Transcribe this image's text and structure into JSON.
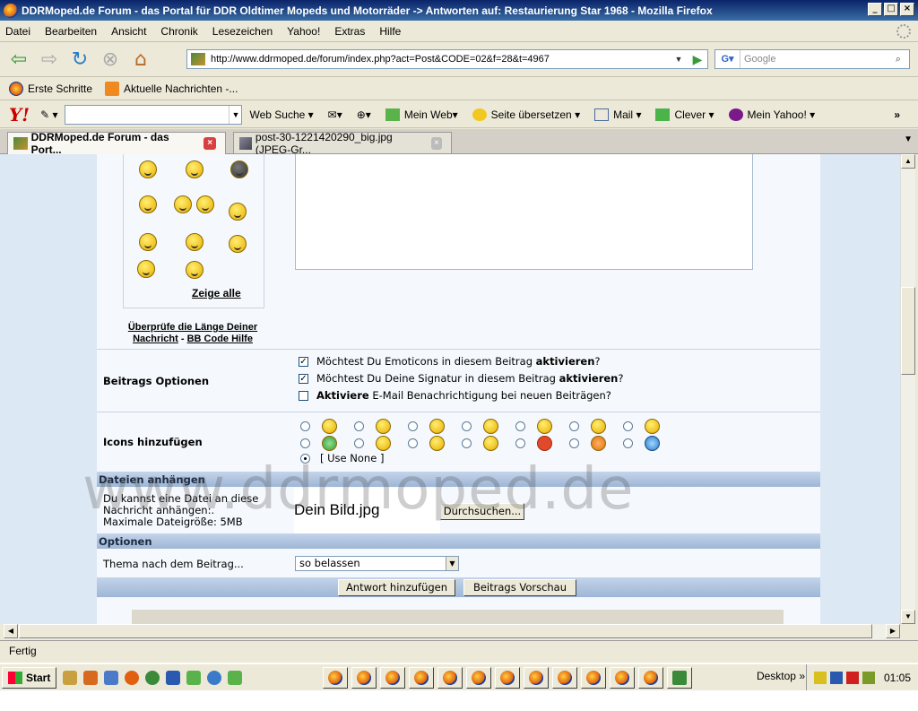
{
  "window": {
    "title": "DDRMoped.de Forum - das Portal für DDR Oldtimer Mopeds und Motorräder -> Antworten auf: Restaurierung Star 1968 - Mozilla Firefox"
  },
  "menu": [
    "Datei",
    "Bearbeiten",
    "Ansicht",
    "Chronik",
    "Lesezeichen",
    "Yahoo!",
    "Extras",
    "Hilfe"
  ],
  "nav": {
    "url": "http://www.ddrmoped.de/forum/index.php?act=Post&CODE=02&f=28&t=4967",
    "search_placeholder": "Google"
  },
  "bookmarks": [
    "Erste Schritte",
    "Aktuelle Nachrichten -..."
  ],
  "yahoo": {
    "items": [
      "Web Suche",
      "Mein Web",
      "Seite übersetzen",
      "Mail",
      "Clever",
      "Mein Yahoo!"
    ],
    "more": "»"
  },
  "tabs": [
    {
      "label": "DDRMoped.de Forum - das Port..."
    },
    {
      "label": "post-30-1221420290_big.jpg (JPEG-Gr..."
    }
  ],
  "page": {
    "show_all": "Zeige alle",
    "check_length": "Überprüfe die Länge Deiner Nachricht",
    "bbcode": "BB Code Hilfe",
    "post_options_label": "Beitrags Optionen",
    "opt1_pre": "Möchtest Du Emoticons in diesem Beitrag ",
    "opt1_b": "aktivieren",
    "opt1_post": "?",
    "opt2_pre": "Möchtest Du Deine Signatur in diesem Beitrag ",
    "opt2_b": "aktivieren",
    "opt2_post": "?",
    "opt3_b": "Aktiviere",
    "opt3_post": " E-Mail Benachrichtigung bei neuen Beiträgen?",
    "icons_label": "Icons hinzufügen",
    "use_none": "[ Use None ]",
    "attach_header": "Dateien anhängen",
    "attach_text1": "Du kannst eine Datei an diese",
    "attach_text2": "Nachricht anhängen:.",
    "attach_text3": "Maximale Dateigröße: 5MB",
    "file_value": "Dein Bild.jpg",
    "browse": "Durchsuchen...",
    "options_header": "Optionen",
    "topic_label": "Thema nach dem Beitrag...",
    "topic_value": "so belassen",
    "submit": "Antwort hinzufügen",
    "preview": "Beitrags Vorschau",
    "watermark": "www.ddrmoped.de"
  },
  "status": "Fertig",
  "taskbar": {
    "start": "Start",
    "desktop": "Desktop",
    "clock": "01:05"
  }
}
